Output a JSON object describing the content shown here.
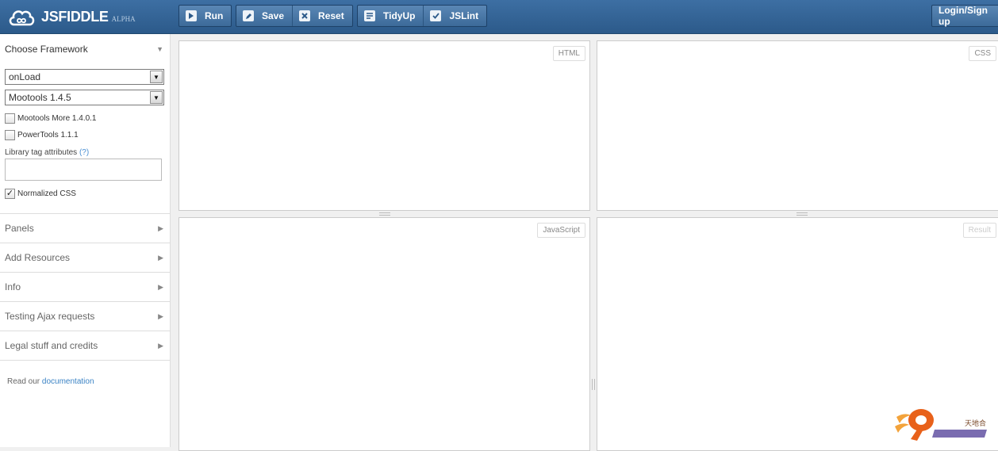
{
  "app": {
    "name": "JSFIDDLE",
    "tag": "ALPHA"
  },
  "toolbar": {
    "run_label": "Run",
    "save_label": "Save",
    "reset_label": "Reset",
    "tidyup_label": "TidyUp",
    "jslint_label": "JSLint",
    "login_label": "Login/Sign up"
  },
  "sidebar": {
    "framework_title": "Choose Framework",
    "load_select": "onLoad",
    "framework_select": "Mootools 1.4.5",
    "checkboxes": [
      {
        "label": "Mootools More 1.4.0.1",
        "checked": false
      },
      {
        "label": "PowerTools 1.1.1",
        "checked": false
      }
    ],
    "lib_attr_label": "Library tag attributes",
    "lib_attr_help": "(?)",
    "normalized_css_label": "Normalized CSS",
    "normalized_css_checked": true,
    "sections": [
      {
        "label": "Panels"
      },
      {
        "label": "Add Resources"
      },
      {
        "label": "Info"
      },
      {
        "label": "Testing Ajax requests"
      },
      {
        "label": "Legal stuff and credits"
      }
    ],
    "docs_prefix": "Read our",
    "docs_link": "documentation"
  },
  "panels": {
    "html": "HTML",
    "css": "CSS",
    "js": "JavaScript",
    "result": "Result"
  },
  "colors": {
    "topbar": "#3d6fa3",
    "link": "#3b83c5"
  }
}
